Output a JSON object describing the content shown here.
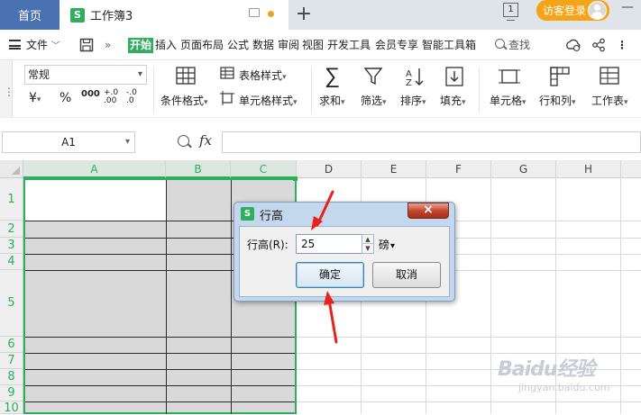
{
  "titlebar": {
    "home_tab": "首页",
    "doc_tab": "工作簿3",
    "logo_letter": "S",
    "add_tab": "+",
    "page_indicator": "1",
    "login_button": "访客登录"
  },
  "menubar": {
    "file": "文件",
    "items": [
      "开始",
      "插入",
      "页面布局",
      "公式",
      "数据",
      "审阅",
      "视图",
      "开发工具",
      "会员专享",
      "智能工具箱"
    ],
    "more": "»",
    "search": "查找"
  },
  "ribbon": {
    "number_format": "常规",
    "number_buttons": [
      "¥",
      "%",
      "000",
      "+.0 .00",
      "-.0 .0"
    ],
    "conditional_format": "条件格式",
    "table_style": "表格样式",
    "cell_style": "单元格样式",
    "sum": "求和",
    "filter": "筛选",
    "sort": "排序",
    "fill": "填充",
    "cell": "单元格",
    "row_col": "行和列",
    "worksheet": "工作表"
  },
  "formulabar": {
    "name_box": "A1",
    "fx": "fx",
    "formula": ""
  },
  "grid": {
    "columns": [
      "A",
      "B",
      "C",
      "D",
      "E",
      "F",
      "G",
      "H"
    ],
    "rows": [
      "1",
      "2",
      "3",
      "4",
      "5",
      "6",
      "7",
      "8",
      "9",
      "10"
    ]
  },
  "dialog": {
    "logo_letter": "S",
    "title": "行高",
    "close": "×",
    "label": "行高(R):",
    "value": "25",
    "unit": "磅",
    "ok": "确定",
    "cancel": "取消"
  },
  "watermark": {
    "text": "Baidu经验",
    "url": "jingyan.baidu.com"
  },
  "colors": {
    "accent": "#2fae5e",
    "home_tab": "#4a72b3",
    "login": "#f3a417",
    "annotation": "#e8221d"
  }
}
